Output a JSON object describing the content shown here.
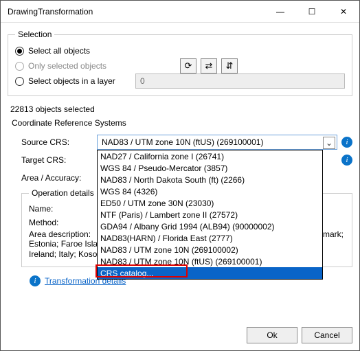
{
  "window": {
    "title": "DrawingTransformation"
  },
  "selection": {
    "legend": "Selection",
    "opt_all": "Select all objects",
    "opt_sel": "Only selected objects",
    "opt_layer": "Select objects in a layer",
    "layer_value": "0"
  },
  "status": "22813 objects selected",
  "crs": {
    "group_title": "Coordinate Reference Systems",
    "source_label": "Source CRS:",
    "source_value": "NAD83 / UTM zone 10N (ftUS) (269100001)",
    "target_label": "Target CRS:",
    "accuracy_label": "Area / Accuracy:",
    "options": [
      "NAD27 / California zone I (26741)",
      "WGS 84 / Pseudo-Mercator (3857)",
      "NAD83 / North Dakota South (ft) (2266)",
      "WGS 84 (4326)",
      "ED50 / UTM zone 30N (23030)",
      "NTF (Paris) / Lambert zone II (27572)",
      "GDA94 / Albany Grid 1994 (ALB94)  (90000002)",
      "NAD83(HARN) / Florida East (2777)",
      "NAD83 / UTM zone 10N (269100002)",
      "NAD83 / UTM zone 10N (ftUS) (269100001)",
      "CRS catalog..."
    ],
    "selected_index": 10
  },
  "op": {
    "legend": "Operation details",
    "name_label": "Name:",
    "method_label": "Method:",
    "area_label": "Area description:",
    "area_value_frag1": "mark;",
    "area_value_frag2": "Estonia; Faroe Islands; Finland; France; Germany; Gibraltar; Greece; Hungary; Ireland; Italy; Kosovo; Latvia; Liechtenstein; Lithuania; Luxem..."
  },
  "transformation_link": "Transformation details",
  "footer": {
    "ok": "Ok",
    "cancel": "Cancel"
  },
  "icons": {
    "minimize_glyph": "—",
    "maximize_glyph": "☐",
    "close_glyph": "✕",
    "chev_glyph": "⌄",
    "info_glyph": "i",
    "tool1_glyph": "⟳",
    "tool2_glyph": "⇄",
    "tool3_glyph": "⇵"
  }
}
